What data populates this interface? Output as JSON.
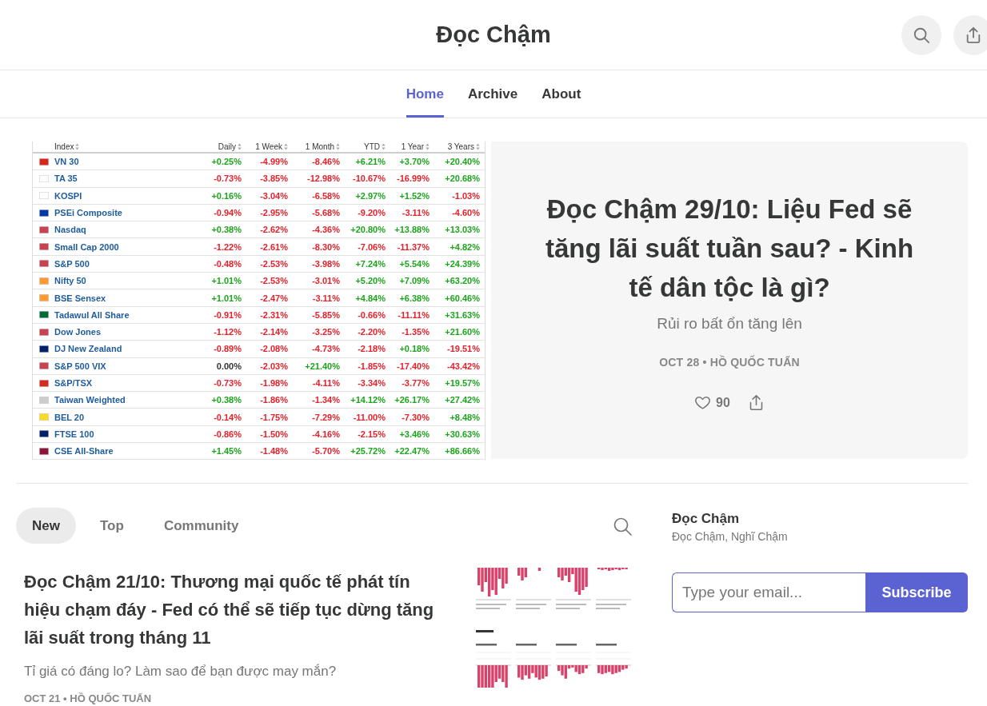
{
  "header": {
    "title": "Đọc Chậm"
  },
  "nav": [
    {
      "label": "Home",
      "selected": true
    },
    {
      "label": "Archive",
      "selected": false
    },
    {
      "label": "About",
      "selected": false
    }
  ],
  "featured": {
    "table": {
      "columns": [
        "Index",
        "Daily",
        "1 Week",
        "1 Month",
        "YTD",
        "1 Year",
        "3 Years"
      ],
      "rows": [
        {
          "color": "#da251d",
          "cells": [
            {
              "text": "VN 30"
            },
            {
              "text": "+0.25%",
              "color": "#1ea51e"
            },
            {
              "text": "-4.99%",
              "color": "#e5222b"
            },
            {
              "text": "-8.46%",
              "color": "#e5222b"
            },
            {
              "text": "+6.21%",
              "color": "#1ea51e"
            },
            {
              "text": "+3.70%",
              "color": "#1ea51e"
            },
            {
              "text": "+20.40%",
              "color": "#1ea51e"
            }
          ]
        },
        {
          "color": "#ffffff",
          "cells": [
            {
              "text": "TA 35"
            },
            {
              "text": "-0.73%",
              "color": "#e5222b"
            },
            {
              "text": "-3.85%",
              "color": "#e5222b"
            },
            {
              "text": "-12.98%",
              "color": "#e5222b"
            },
            {
              "text": "-10.67%",
              "color": "#e5222b"
            },
            {
              "text": "-16.99%",
              "color": "#e5222b"
            },
            {
              "text": "+20.68%",
              "color": "#1ea51e"
            }
          ]
        },
        {
          "color": "#ffffff",
          "cells": [
            {
              "text": "KOSPI"
            },
            {
              "text": "+0.16%",
              "color": "#1ea51e"
            },
            {
              "text": "-3.04%",
              "color": "#e5222b"
            },
            {
              "text": "-6.58%",
              "color": "#e5222b"
            },
            {
              "text": "+2.97%",
              "color": "#1ea51e"
            },
            {
              "text": "+1.52%",
              "color": "#1ea51e"
            },
            {
              "text": "-1.03%",
              "color": "#e5222b"
            }
          ]
        },
        {
          "color": "#0038a8",
          "cells": [
            {
              "text": "PSEi Composite"
            },
            {
              "text": "-0.94%",
              "color": "#e5222b"
            },
            {
              "text": "-2.95%",
              "color": "#e5222b"
            },
            {
              "text": "-5.68%",
              "color": "#e5222b"
            },
            {
              "text": "-9.20%",
              "color": "#e5222b"
            },
            {
              "text": "-3.11%",
              "color": "#e5222b"
            },
            {
              "text": "-4.60%",
              "color": "#e5222b"
            }
          ]
        },
        {
          "color": "#c8424f",
          "cells": [
            {
              "text": "Nasdaq"
            },
            {
              "text": "+0.38%",
              "color": "#1ea51e"
            },
            {
              "text": "-2.62%",
              "color": "#e5222b"
            },
            {
              "text": "-4.36%",
              "color": "#e5222b"
            },
            {
              "text": "+20.80%",
              "color": "#1ea51e"
            },
            {
              "text": "+13.88%",
              "color": "#1ea51e"
            },
            {
              "text": "+13.03%",
              "color": "#1ea51e"
            }
          ]
        },
        {
          "color": "#c8424f",
          "cells": [
            {
              "text": "Small Cap 2000"
            },
            {
              "text": "-1.22%",
              "color": "#e5222b"
            },
            {
              "text": "-2.61%",
              "color": "#e5222b"
            },
            {
              "text": "-8.30%",
              "color": "#e5222b"
            },
            {
              "text": "-7.06%",
              "color": "#e5222b"
            },
            {
              "text": "-11.37%",
              "color": "#e5222b"
            },
            {
              "text": "+4.82%",
              "color": "#1ea51e"
            }
          ]
        },
        {
          "color": "#c8424f",
          "cells": [
            {
              "text": "S&P 500"
            },
            {
              "text": "-0.48%",
              "color": "#e5222b"
            },
            {
              "text": "-2.53%",
              "color": "#e5222b"
            },
            {
              "text": "-3.98%",
              "color": "#e5222b"
            },
            {
              "text": "+7.24%",
              "color": "#1ea51e"
            },
            {
              "text": "+5.54%",
              "color": "#1ea51e"
            },
            {
              "text": "+24.39%",
              "color": "#1ea51e"
            }
          ]
        },
        {
          "color": "#ff9933",
          "cells": [
            {
              "text": "Nifty 50"
            },
            {
              "text": "+1.01%",
              "color": "#1ea51e"
            },
            {
              "text": "-2.53%",
              "color": "#e5222b"
            },
            {
              "text": "-3.01%",
              "color": "#e5222b"
            },
            {
              "text": "+5.20%",
              "color": "#1ea51e"
            },
            {
              "text": "+7.09%",
              "color": "#1ea51e"
            },
            {
              "text": "+63.20%",
              "color": "#1ea51e"
            }
          ]
        },
        {
          "color": "#ff9933",
          "cells": [
            {
              "text": "BSE Sensex"
            },
            {
              "text": "+1.01%",
              "color": "#1ea51e"
            },
            {
              "text": "-2.47%",
              "color": "#e5222b"
            },
            {
              "text": "-3.11%",
              "color": "#e5222b"
            },
            {
              "text": "+4.84%",
              "color": "#1ea51e"
            },
            {
              "text": "+6.38%",
              "color": "#1ea51e"
            },
            {
              "text": "+60.46%",
              "color": "#1ea51e"
            }
          ]
        },
        {
          "color": "#006c35",
          "cells": [
            {
              "text": "Tadawul All Share"
            },
            {
              "text": "-0.91%",
              "color": "#e5222b"
            },
            {
              "text": "-2.31%",
              "color": "#e5222b"
            },
            {
              "text": "-5.85%",
              "color": "#e5222b"
            },
            {
              "text": "-0.66%",
              "color": "#e5222b"
            },
            {
              "text": "-11.11%",
              "color": "#e5222b"
            },
            {
              "text": "+31.63%",
              "color": "#1ea51e"
            }
          ]
        },
        {
          "color": "#c8424f",
          "cells": [
            {
              "text": "Dow Jones"
            },
            {
              "text": "-1.12%",
              "color": "#e5222b"
            },
            {
              "text": "-2.14%",
              "color": "#e5222b"
            },
            {
              "text": "-3.25%",
              "color": "#e5222b"
            },
            {
              "text": "-2.20%",
              "color": "#e5222b"
            },
            {
              "text": "-1.35%",
              "color": "#e5222b"
            },
            {
              "text": "+21.60%",
              "color": "#1ea51e"
            }
          ]
        },
        {
          "color": "#012169",
          "cells": [
            {
              "text": "DJ New Zealand"
            },
            {
              "text": "-0.89%",
              "color": "#e5222b"
            },
            {
              "text": "-2.08%",
              "color": "#e5222b"
            },
            {
              "text": "-4.73%",
              "color": "#e5222b"
            },
            {
              "text": "-2.18%",
              "color": "#e5222b"
            },
            {
              "text": "+0.18%",
              "color": "#1ea51e"
            },
            {
              "text": "-19.51%",
              "color": "#e5222b"
            }
          ]
        },
        {
          "color": "#c8424f",
          "cells": [
            {
              "text": "S&P 500 VIX"
            },
            {
              "text": "0.00%",
              "color": "#333333"
            },
            {
              "text": "-2.03%",
              "color": "#e5222b"
            },
            {
              "text": "+21.40%",
              "color": "#1ea51e"
            },
            {
              "text": "-1.85%",
              "color": "#e5222b"
            },
            {
              "text": "-17.40%",
              "color": "#e5222b"
            },
            {
              "text": "-43.42%",
              "color": "#e5222b"
            }
          ]
        },
        {
          "color": "#d52b1e",
          "cells": [
            {
              "text": "S&P/TSX"
            },
            {
              "text": "-0.73%",
              "color": "#e5222b"
            },
            {
              "text": "-1.98%",
              "color": "#e5222b"
            },
            {
              "text": "-4.11%",
              "color": "#e5222b"
            },
            {
              "text": "-3.34%",
              "color": "#e5222b"
            },
            {
              "text": "-3.77%",
              "color": "#e5222b"
            },
            {
              "text": "+19.57%",
              "color": "#1ea51e"
            }
          ]
        },
        {
          "color": "#cccccc",
          "cells": [
            {
              "text": "Taiwan Weighted"
            },
            {
              "text": "+0.38%",
              "color": "#1ea51e"
            },
            {
              "text": "-1.86%",
              "color": "#e5222b"
            },
            {
              "text": "-1.34%",
              "color": "#e5222b"
            },
            {
              "text": "+14.12%",
              "color": "#1ea51e"
            },
            {
              "text": "+26.17%",
              "color": "#1ea51e"
            },
            {
              "text": "+27.42%",
              "color": "#1ea51e"
            }
          ]
        },
        {
          "color": "#fdda24",
          "cells": [
            {
              "text": "BEL 20"
            },
            {
              "text": "-0.14%",
              "color": "#e5222b"
            },
            {
              "text": "-1.75%",
              "color": "#e5222b"
            },
            {
              "text": "-7.29%",
              "color": "#e5222b"
            },
            {
              "text": "-11.00%",
              "color": "#e5222b"
            },
            {
              "text": "-7.30%",
              "color": "#e5222b"
            },
            {
              "text": "+8.48%",
              "color": "#1ea51e"
            }
          ]
        },
        {
          "color": "#012169",
          "cells": [
            {
              "text": "FTSE 100"
            },
            {
              "text": "-0.86%",
              "color": "#e5222b"
            },
            {
              "text": "-1.50%",
              "color": "#e5222b"
            },
            {
              "text": "-4.16%",
              "color": "#e5222b"
            },
            {
              "text": "-2.15%",
              "color": "#e5222b"
            },
            {
              "text": "+3.46%",
              "color": "#1ea51e"
            },
            {
              "text": "+30.63%",
              "color": "#1ea51e"
            }
          ]
        },
        {
          "color": "#8d153a",
          "cells": [
            {
              "text": "CSE All-Share"
            },
            {
              "text": "+1.45%",
              "color": "#1ea51e"
            },
            {
              "text": "-1.48%",
              "color": "#e5222b"
            },
            {
              "text": "-5.70%",
              "color": "#e5222b"
            },
            {
              "text": "+25.72%",
              "color": "#1ea51e"
            },
            {
              "text": "+22.47%",
              "color": "#1ea51e"
            },
            {
              "text": "+86.66%",
              "color": "#1ea51e"
            }
          ]
        }
      ]
    },
    "title": "Đọc Chậm 29/10: Liệu Fed sẽ tăng lãi suất tuần sau? - Kinh tế dân tộc là gì?",
    "subtitle": "Rủi ro bất ổn tăng lên",
    "meta": "OCT 28 • HỒ QUỐC TUẤN",
    "likes": "90"
  },
  "feed": {
    "tabs": [
      {
        "label": "New",
        "selected": true
      },
      {
        "label": "Top",
        "selected": false
      },
      {
        "label": "Community",
        "selected": false
      }
    ],
    "posts": [
      {
        "title": "Đọc Chậm 21/10: Thương mại quốc tế phát tín hiệu chạm đáy - Fed có thể sẽ tiếp tục dừng tăng lãi suất trong tháng 11",
        "subtitle": "Tỉ giá có đáng lo? Làm sao để bạn được may mắn?",
        "meta": "OCT 21 • HỒ QUỐC TUẤN"
      }
    ]
  },
  "sidebar": {
    "name": "Đọc Chậm",
    "tagline": "Đọc Chậm, Nghĩ Chậm",
    "email": {
      "placeholder": "Type your email..."
    },
    "button": "Subscribe"
  }
}
